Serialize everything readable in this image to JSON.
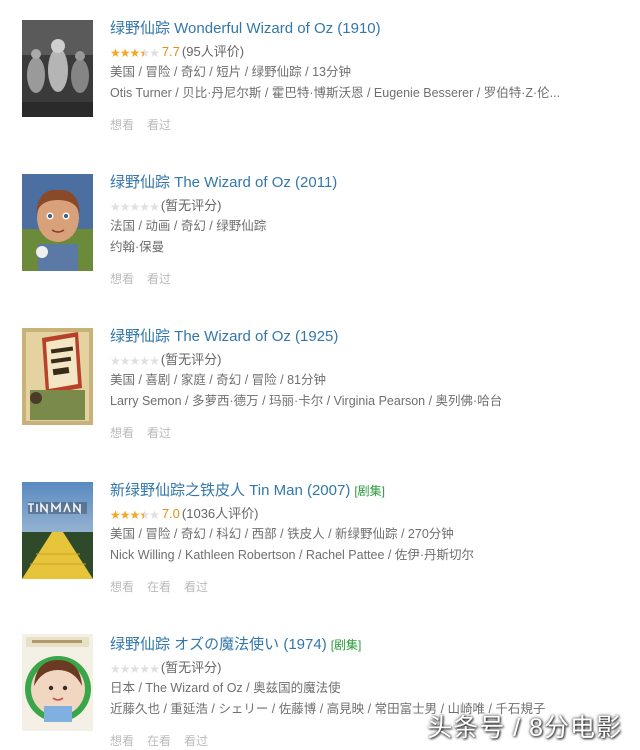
{
  "items": [
    {
      "title": "绿野仙踪 Wonderful Wizard of Oz (1910)",
      "rating": 3.85,
      "score": "7.7",
      "rating_count": "(95人评价)",
      "meta": "美国 / 冒险 / 奇幻 / 短片 / 绿野仙踪 / 13分钟",
      "people": "Otis Turner / 贝比·丹尼尔斯 / 霍巴特·博斯沃恩 / Eugenie Besserer / 罗伯特·Z·伦...",
      "actions": [
        "想看",
        "看过"
      ]
    },
    {
      "title": "绿野仙踪 The Wizard of Oz (2011)",
      "rating": 0,
      "score": "",
      "rating_count": "(暂无评分)",
      "meta": "法国 / 动画 / 奇幻 / 绿野仙踪",
      "people": "约翰·保曼",
      "actions": [
        "想看",
        "看过"
      ]
    },
    {
      "title": "绿野仙踪 The Wizard of Oz (1925)",
      "rating": 0,
      "score": "",
      "rating_count": "(暂无评分)",
      "meta": "美国 / 喜剧 / 家庭 / 奇幻 / 冒险 / 81分钟",
      "people": "Larry Semon / 多萝西·德万 / 玛丽·卡尔 / Virginia Pearson / 奥列佛·哈台",
      "actions": [
        "想看",
        "看过"
      ]
    },
    {
      "title": "新绿野仙踪之铁皮人 Tin Man (2007)",
      "tag": "[剧集]",
      "rating": 3.5,
      "score": "7.0",
      "rating_count": "(1036人评价)",
      "meta": "美国 / 冒险 / 奇幻 / 科幻 / 西部 / 铁皮人 / 新绿野仙踪 / 270分钟",
      "people": "Nick Willing / Kathleen Robertson / Rachel Pattee / 佐伊·丹斯切尔",
      "actions": [
        "想看",
        "在看",
        "看过"
      ]
    },
    {
      "title": "绿野仙踪 オズの魔法使い (1974)",
      "tag": "[剧集]",
      "rating": 0,
      "score": "",
      "rating_count": "(暂无评分)",
      "meta": "日本 / The Wizard of Oz / 奥兹国的魔法使",
      "people": "近藤久也 / 重延浩 / シェリー / 佐藤博 / 高見映 / 常田富士男 / 山崎唯 / 千石規子",
      "actions": [
        "想看",
        "在看",
        "看过"
      ]
    }
  ],
  "watermark": "头条号 / 8分电影"
}
